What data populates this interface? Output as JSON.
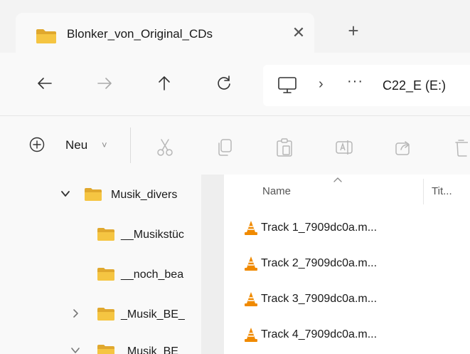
{
  "tab": {
    "title": "Blonker_von_Original_CDs",
    "close_glyph": "✕",
    "new_tab_glyph": "+"
  },
  "nav": {
    "back": "←",
    "forward": "→",
    "up": "↑",
    "refresh": "↻"
  },
  "address": {
    "chevron": "›",
    "overflow": "···",
    "path": "C22_E (E:)"
  },
  "toolbar": {
    "new_label": "Neu",
    "new_caret": "˅"
  },
  "tree": [
    {
      "label": "Musik_divers",
      "caret": "⌄"
    },
    {
      "label": "__Musikstüc",
      "caret": ""
    },
    {
      "label": "__noch_bea",
      "caret": ""
    },
    {
      "label": "_Musik_BE_",
      "caret": "›"
    },
    {
      "label": "_Musik_BE",
      "caret": "⌄"
    }
  ],
  "columns": {
    "name": "Name",
    "title": "Tit..."
  },
  "files": [
    {
      "name": "Track 1_7909dc0a.m..."
    },
    {
      "name": "Track 2_7909dc0a.m..."
    },
    {
      "name": "Track 3_7909dc0a.m..."
    },
    {
      "name": "Track 4_7909dc0a.m..."
    }
  ],
  "colors": {
    "folder": "#f5c542",
    "folder_dark": "#e0a82e",
    "vlc_orange": "#f08a00",
    "accent": "#005fb8"
  },
  "icons": {
    "tab": "folder-icon",
    "pc": "computer-icon",
    "toolbar": [
      "plus-circle-icon",
      "cut-icon",
      "copy-icon",
      "paste-icon",
      "rename-icon",
      "share-icon",
      "delete-icon"
    ],
    "file": "vlc-media-icon"
  }
}
